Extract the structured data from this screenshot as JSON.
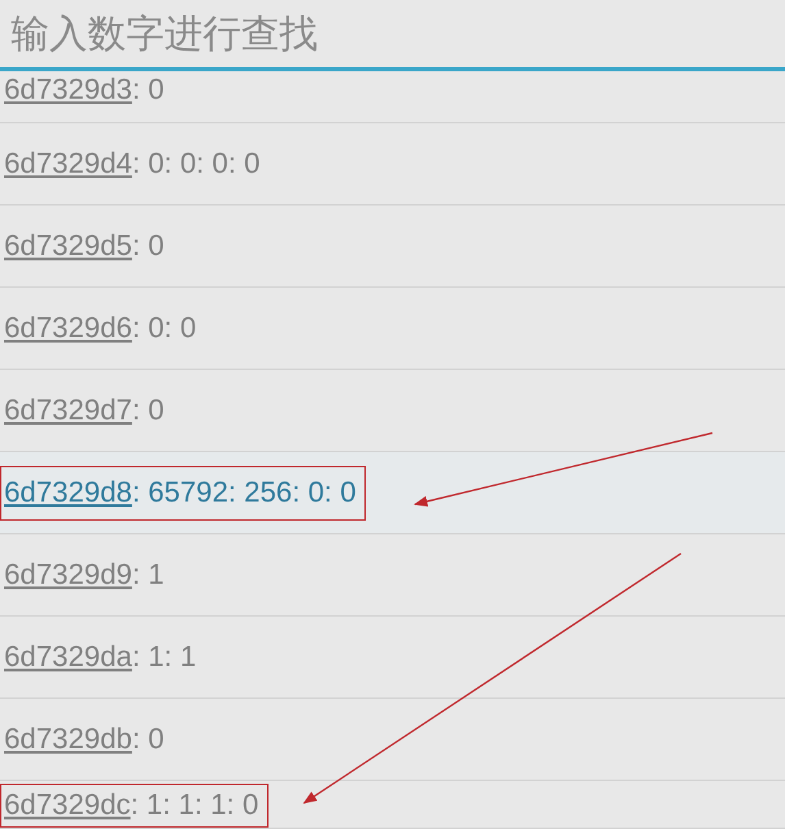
{
  "search": {
    "placeholder": "输入数字进行查找"
  },
  "rows": [
    {
      "key": "6d7329d3",
      "value": ": 0",
      "selected": false,
      "annotated": false
    },
    {
      "key": "6d7329d4",
      "value": ": 0: 0: 0: 0",
      "selected": false,
      "annotated": false
    },
    {
      "key": "6d7329d5",
      "value": ": 0",
      "selected": false,
      "annotated": false
    },
    {
      "key": "6d7329d6",
      "value": ": 0: 0",
      "selected": false,
      "annotated": false
    },
    {
      "key": "6d7329d7",
      "value": ": 0",
      "selected": false,
      "annotated": false
    },
    {
      "key": "6d7329d8",
      "value": ": 65792: 256: 0: 0",
      "selected": true,
      "annotated": true
    },
    {
      "key": "6d7329d9",
      "value": ": 1",
      "selected": false,
      "annotated": false
    },
    {
      "key": "6d7329da",
      "value": ": 1: 1",
      "selected": false,
      "annotated": false
    },
    {
      "key": "6d7329db",
      "value": ": 0",
      "selected": false,
      "annotated": false
    },
    {
      "key": "6d7329dc",
      "value": ": 1: 1: 1: 0",
      "selected": false,
      "annotated": true
    }
  ]
}
